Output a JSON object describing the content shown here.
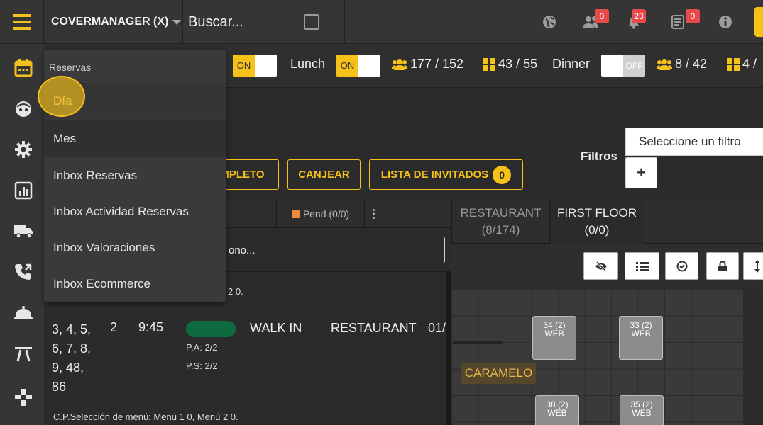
{
  "topbar": {
    "account_name": "COVERMANAGER (X)",
    "search_label": "Buscar...",
    "badges": {
      "users": "0",
      "notifications": "23",
      "tasks": "0"
    },
    "icons": [
      "globe-icon",
      "users-icon",
      "bell-icon",
      "tasks-icon",
      "info-icon"
    ]
  },
  "sidebar": {
    "icons": [
      "calendar-icon",
      "face-icon",
      "gear-icon",
      "chart-icon",
      "truck-icon",
      "phone-icon",
      "cloche-icon",
      "pavilion-icon",
      "gamepad-icon"
    ]
  },
  "shifts": {
    "toggle1_on": "ON",
    "lunch_label": "Lunch",
    "lunch_on": "ON",
    "lunch_pax": "177 / 152",
    "lunch_tables": "43 / 55",
    "dinner_label": "Dinner",
    "dinner_off": "OFF",
    "dinner_pax": "8 / 42",
    "dinner_tables": "4 /"
  },
  "actions": {
    "completo_label": "MPLETO",
    "canjear_label": "CANJEAR",
    "guest_list_label": "LISTA DE INVITADOS",
    "guest_list_count": "0",
    "filters_label": "Filtros",
    "filter_placeholder": "Seleccione un filtro",
    "add_filter": "+"
  },
  "list": {
    "pend_tab": "Pend (0/0)",
    "kebab": "⋮",
    "search_value": "ono...",
    "prev_row_text": "2 0.",
    "rows": [
      {
        "tables": [
          "3, 4, 5,",
          "6, 7, 8,",
          "9, 48,",
          "86"
        ],
        "pax": "2",
        "time": "9:45",
        "type": "WALK IN",
        "zone": "RESTAURANT",
        "date": "01/",
        "pa": "P.A: 2/2",
        "ps": "P.S: 2/2",
        "note": "C.P.Selección de menú: Menú 1 0, Menú 2 0."
      }
    ]
  },
  "floor": {
    "tabs": [
      {
        "name": "RESTAURANT",
        "count": "(8/174)"
      },
      {
        "name": "FIRST FLOOR",
        "count": "(0/0)"
      }
    ],
    "zone_label": "CARAMELO",
    "tables": [
      {
        "name": "34 (2)",
        "source": "WEB"
      },
      {
        "name": "33 (2)",
        "source": "WEB"
      },
      {
        "name": "38 (2)",
        "source": "WEB"
      },
      {
        "name": "35 (2)",
        "source": "WEB"
      }
    ]
  },
  "menu": {
    "header": "Reservas",
    "items": [
      "Día",
      "Mes",
      "Inbox Reservas",
      "Inbox Actividad Reservas",
      "Inbox Valoraciones",
      "Inbox Ecommerce"
    ]
  },
  "colors": {
    "accent": "#f6c21a",
    "badge": "#e84a4a",
    "status_green": "#0e6b3f"
  }
}
